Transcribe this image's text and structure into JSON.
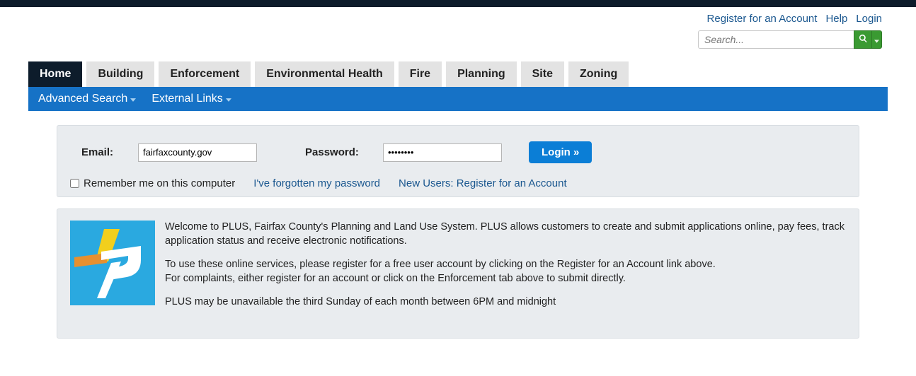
{
  "header": {
    "register": "Register for an Account",
    "help": "Help",
    "login": "Login",
    "search_placeholder": "Search..."
  },
  "tabs": [
    {
      "label": "Home",
      "active": true
    },
    {
      "label": "Building",
      "active": false
    },
    {
      "label": "Enforcement",
      "active": false
    },
    {
      "label": "Environmental Health",
      "active": false
    },
    {
      "label": "Fire",
      "active": false
    },
    {
      "label": "Planning",
      "active": false
    },
    {
      "label": "Site",
      "active": false
    },
    {
      "label": "Zoning",
      "active": false
    }
  ],
  "subnav": {
    "advanced": "Advanced Search",
    "external": "External Links"
  },
  "login": {
    "email_label": "Email:",
    "email_value": "fairfaxcounty.gov",
    "password_label": "Password:",
    "password_value": "••••••••",
    "button": "Login »",
    "remember": "Remember me on this computer",
    "forgot": "I've forgotten my password",
    "newusers": "New Users: Register for an Account"
  },
  "welcome": {
    "p1": "Welcome to PLUS, Fairfax County's Planning and Land Use System. PLUS allows customers to create and submit applications online, pay fees, track application status and receive electronic notifications.",
    "p2a": "To use these online services, please register for a free user account by clicking on the Register for an Account link above.",
    "p2b": "For complaints, either register for an account or click on the Enforcement tab above to submit directly.",
    "p3": "PLUS may be unavailable the third Sunday of each month between 6PM and midnight"
  }
}
